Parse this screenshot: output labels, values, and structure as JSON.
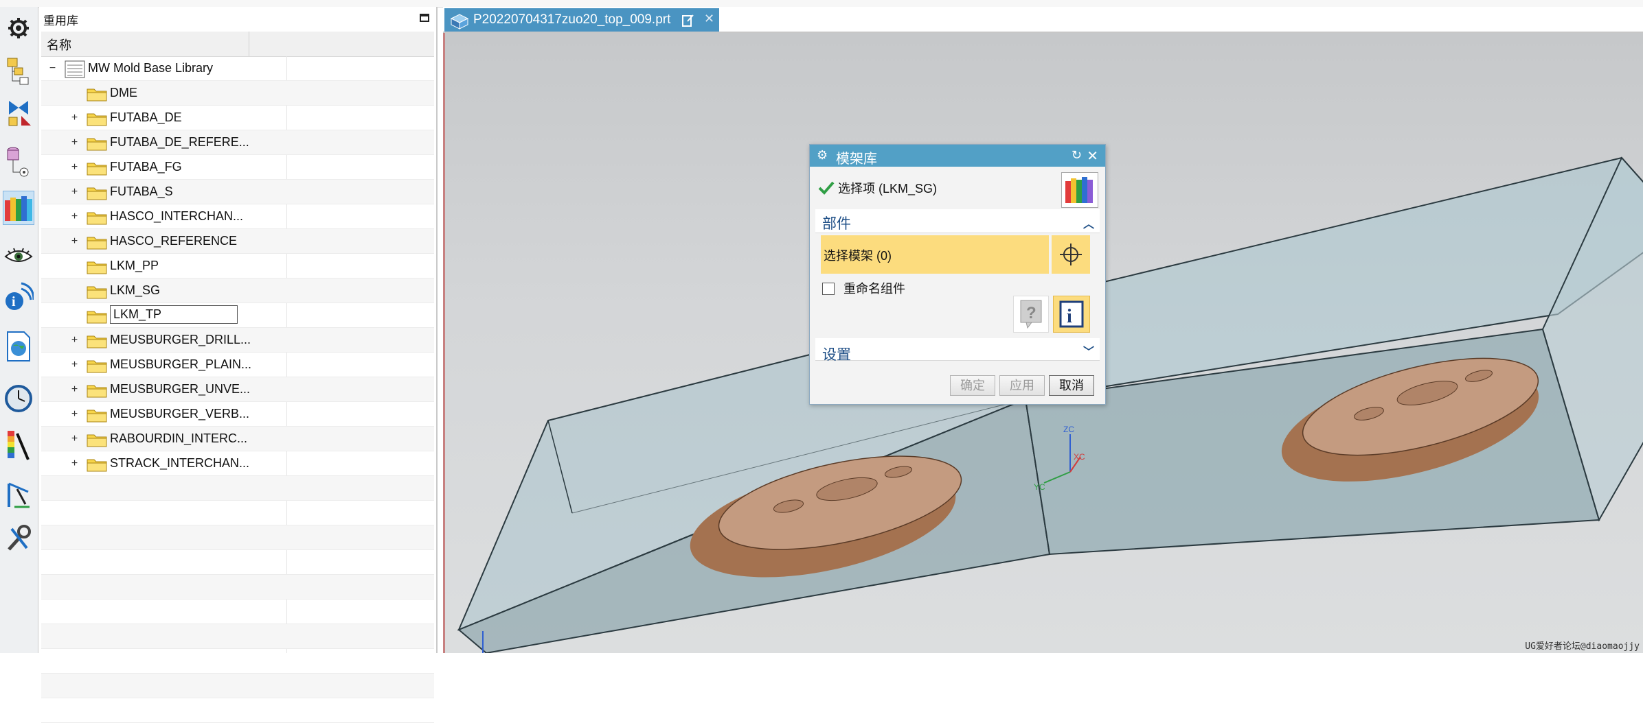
{
  "reuse_library": {
    "title": "重用库",
    "column_name": "名称",
    "root": "MW Mold Base Library",
    "items": [
      {
        "label": "DME",
        "expandable": false
      },
      {
        "label": "FUTABA_DE",
        "expandable": true
      },
      {
        "label": "FUTABA_DE_REFERE...",
        "expandable": true
      },
      {
        "label": "FUTABA_FG",
        "expandable": true
      },
      {
        "label": "FUTABA_S",
        "expandable": true
      },
      {
        "label": "HASCO_INTERCHAN...",
        "expandable": true
      },
      {
        "label": "HASCO_REFERENCE",
        "expandable": true
      },
      {
        "label": "LKM_PP",
        "expandable": false
      },
      {
        "label": "LKM_SG",
        "expandable": false
      },
      {
        "label": "LKM_TP",
        "expandable": false,
        "selected": true
      },
      {
        "label": "MEUSBURGER_DRILL...",
        "expandable": true
      },
      {
        "label": "MEUSBURGER_PLAIN...",
        "expandable": true
      },
      {
        "label": "MEUSBURGER_UNVE...",
        "expandable": true
      },
      {
        "label": "MEUSBURGER_VERB...",
        "expandable": true
      },
      {
        "label": "RABOURDIN_INTERC...",
        "expandable": true
      },
      {
        "label": "STRACK_INTERCHAN...",
        "expandable": true
      }
    ]
  },
  "left_toolbar": {
    "icons": [
      "settings-gear-icon",
      "assembly-navigator-icon",
      "constraint-navigator-icon",
      "part-navigator-icon",
      "reuse-library-icon",
      "visualization-eye-icon",
      "info-signal-icon",
      "web-browser-icon",
      "history-clock-icon",
      "color-palette-icon",
      "process-tools-icon",
      "roles-tools-icon"
    ]
  },
  "tab": {
    "label": "P20220704317zuo20_top_009.prt"
  },
  "viewport": {
    "axis_zc": "ZC",
    "axis_yc": "YC",
    "axis_xc": "XC",
    "watermark": "UG爱好者论坛@diaomaojjy"
  },
  "dialog": {
    "title": "模架库",
    "selection_item": "选择项 (LKM_SG)",
    "section_parts": "部件",
    "select_frame": "选择模架 (0)",
    "rename_label": "重命名组件",
    "section_settings": "设置",
    "btn_ok": "确定",
    "btn_apply": "应用",
    "btn_cancel": "取消"
  },
  "colors": {
    "tab_blue": "#4a94c2",
    "dialog_title_blue": "#52a0c6",
    "highlight_yellow": "#fcdc7e",
    "section_blue_text": "#1d4e86"
  }
}
